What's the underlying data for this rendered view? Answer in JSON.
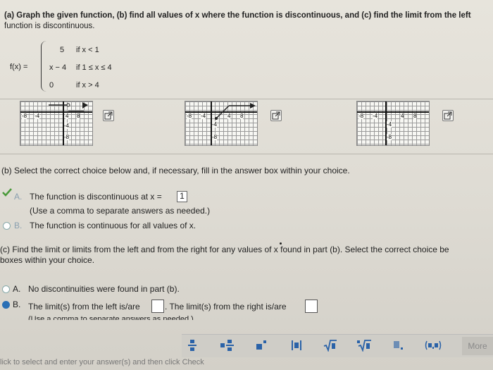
{
  "question": {
    "line1": "(a) Graph the given function, (b) find all values of x where the function is discontinuous, and (c) find the limit from the left",
    "line2": "function is discontinuous."
  },
  "function": {
    "lhs": "f(x) =",
    "pieces": [
      {
        "value": "5",
        "condition": "if x < 1"
      },
      {
        "value": "x − 4",
        "condition": "if 1 ≤ x ≤ 4"
      },
      {
        "value": "0",
        "condition": "if x > 4"
      }
    ]
  },
  "graphs": [
    {
      "ticks": [
        "-8",
        "-4",
        "4",
        "8",
        "-4",
        "-8"
      ]
    },
    {
      "ticks": [
        "-8",
        "-4",
        "4",
        "8",
        "-4",
        "-8"
      ]
    },
    {
      "ticks": [
        "-8",
        "-4",
        "4",
        "8",
        "-4",
        "-8"
      ]
    }
  ],
  "part_b": {
    "prompt": "(b) Select the correct choice below and, if necessary, fill in the answer box within your choice.",
    "choice_a_letter": "A.",
    "choice_a_text": "The function is discontinuous at x =",
    "choice_a_answer": "1",
    "choice_a_hint": "(Use a comma to separate answers as needed.)",
    "choice_b_letter": "B.",
    "choice_b_text": "The function is continuous for all values of x."
  },
  "part_c": {
    "prompt_line1": "(c) Find the limit or limits from the left and from the right for any values of x found in part (b). Select the correct choice be",
    "prompt_line2": "boxes within your choice.",
    "choice_a_letter": "A.",
    "choice_a_text": "No discontinuities were found in part (b).",
    "choice_b_letter": "B.",
    "choice_b_text1": "The limit(s) from the left is/are",
    "choice_b_text2": ". The limit(s) from the right is/are",
    "choice_b_hint": "(Use a comma to separate answers as needed.)"
  },
  "toolbar": {
    "more_label": "More"
  },
  "footer": {
    "text": "lick to select and enter your answer(s) and then click Check"
  },
  "colors": {
    "accent": "#2a62a8",
    "selected_radio": "#2a6fb5",
    "check_green": "#4a9a3a"
  }
}
